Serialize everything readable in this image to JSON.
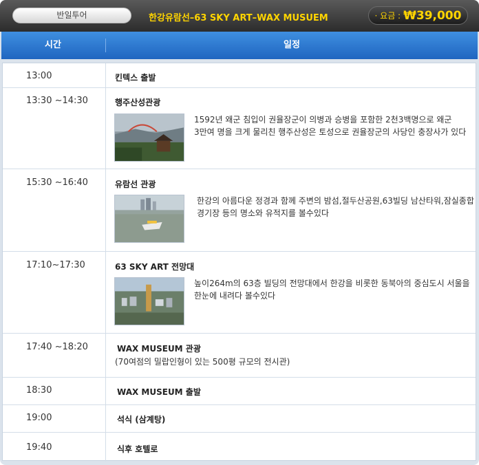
{
  "header": {
    "tour_type": "반일투어",
    "tour_title": "한강유람선–63 SKY ART–WAX MUSUEM",
    "price_label": "· 요금 :",
    "price_value": "₩39,000"
  },
  "columns": {
    "time": "시간",
    "schedule": "일정"
  },
  "rows": [
    {
      "time": "13:00",
      "place": "킨텍스 출발"
    },
    {
      "time": "13:30 ~14:30",
      "place": "행주산성관광",
      "desc_line1": "1592년 왜군 침입이 권율장군이 의병과 승병을 포함한 2천3백명으로 왜군",
      "desc_line2": "3만여 명을 크게 물리친 행주산성은 토성으로 권율장군의 사당인 충장사가 있다"
    },
    {
      "time": "15:30 ~16:40",
      "place": "유람선 관광",
      "desc_line1": "한강의 아름다운 정경과 함께 주변의 밤섬,절두산공원,63빌딩 남산타워,잠실종합",
      "desc_line2": "경기장 등의 명소와 유적지를 볼수있다"
    },
    {
      "time": "17:10~17:30",
      "place": "63 SKY ART 전망대",
      "desc_line1": "높이264m의 63층 빌딩의 전망대에서 한강을 비롯한 동북아의 중심도시 서울을",
      "desc_line2": "한눈에 내려다 볼수있다"
    },
    {
      "time": "17:40 ~18:20",
      "place": "WAX MUSEUM 관광",
      "sub": "(70여점의 밀랍인형이 있는 500평 규모의 전시관)"
    },
    {
      "time": "18:30",
      "place": "WAX MUSEUM 출발"
    },
    {
      "time": "19:00",
      "place": "석식 (삼계탕)"
    },
    {
      "time": "19:40",
      "place": "식후 호텔로"
    }
  ],
  "photos": {
    "haengju": "haengju-fortress-pavilion-photo",
    "cruise": "han-river-cruise-photo",
    "sky": "63-building-city-view-photo"
  },
  "colors": {
    "accent_yellow": "#ffd400",
    "header_blue": "#2a74cc",
    "border": "#d3dde8"
  }
}
